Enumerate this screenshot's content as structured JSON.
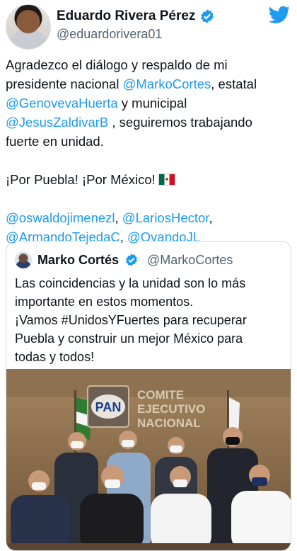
{
  "tweet": {
    "display_name": "Eduardo Rivera Pérez",
    "handle": "@eduardorivera01",
    "lines": [
      [
        {
          "t": "Agradezco el diálogo y respaldo de mi",
          "m": false
        }
      ],
      [
        {
          "t": "presidente nacional ",
          "m": false
        },
        {
          "t": "@MarkoCortes",
          "m": true
        },
        {
          "t": ", estatal",
          "m": false
        }
      ],
      [
        {
          "t": "@GenovevaHuerta",
          "m": true
        },
        {
          "t": " y municipal",
          "m": false
        }
      ],
      [
        {
          "t": "@JesusZaldivarB",
          "m": true
        },
        {
          "t": " , seguiremos trabajando",
          "m": false
        }
      ],
      [
        {
          "t": "fuerte en unidad.",
          "m": false
        }
      ],
      [],
      [
        {
          "t": "¡Por Puebla! ¡Por México!",
          "m": false,
          "flag": true
        }
      ],
      [],
      [
        {
          "t": "@oswaldojimenezl",
          "m": true
        },
        {
          "t": ", ",
          "m": false
        },
        {
          "t": "@LariosHector",
          "m": true
        },
        {
          "t": ",",
          "m": false
        }
      ],
      [
        {
          "t": "@ArmandoTejedaC",
          "m": true
        },
        {
          "t": ", ",
          "m": false
        },
        {
          "t": "@OvandoJL",
          "m": true
        }
      ]
    ]
  },
  "quoted": {
    "display_name": "Marko Cortés",
    "handle": "@MarkoCortes",
    "lines": [
      "Las coincidencias y la unidad son lo más",
      "importante en estos momentos.",
      "¡Vamos #UnidosYFuertes para recuperar",
      "Puebla y construir un mejor México para",
      "todas y todos!"
    ],
    "photo_logo": "PAN",
    "photo_sign": [
      "COMITE",
      "EJECUTIVO",
      "NACIONAL"
    ]
  },
  "colors": {
    "mention": "#1d9bf0",
    "verified": "#1d9bf0",
    "handle": "#536471"
  },
  "icons": [
    "verified-icon",
    "twitter-bird-icon",
    "mexico-flag-icon"
  ]
}
